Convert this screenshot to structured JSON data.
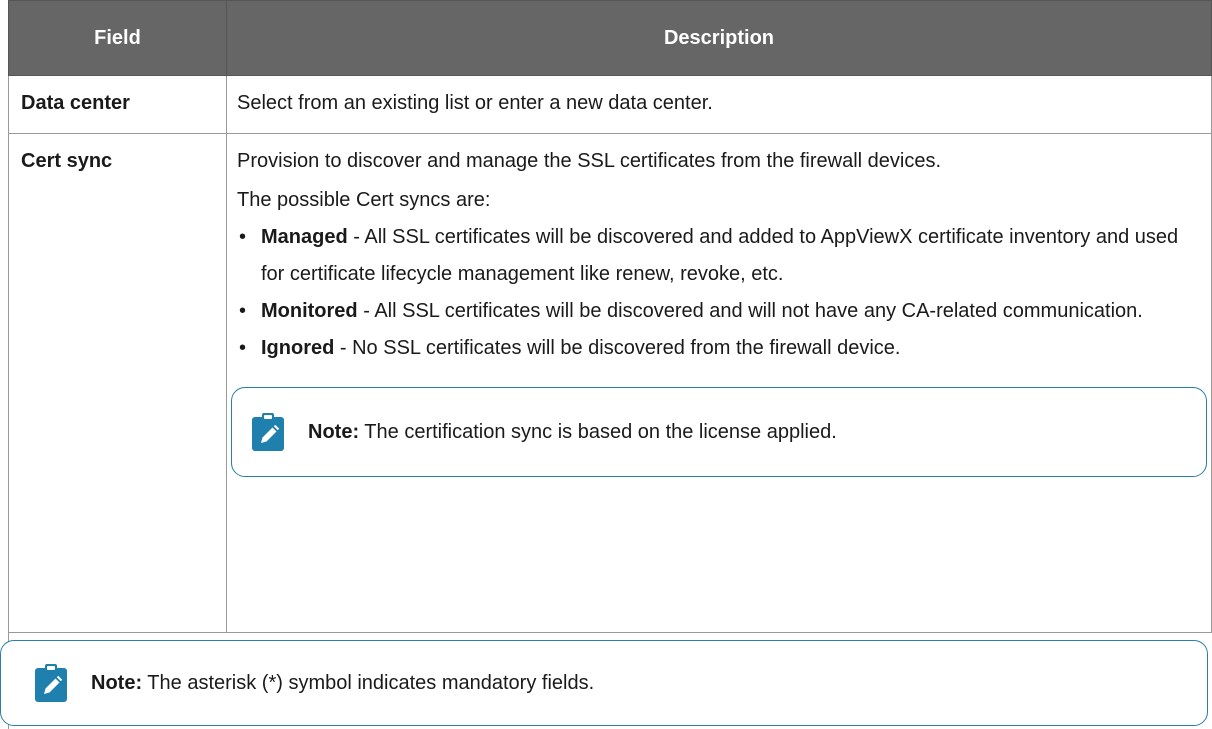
{
  "table": {
    "headers": {
      "field": "Field",
      "description": "Description"
    },
    "rows": {
      "data_center": {
        "field": "Data center",
        "description": "Select from an existing list or enter a new data center."
      },
      "cert_sync": {
        "field": "Cert sync",
        "intro": "Provision to discover and manage the SSL certificates from the firewall devices.",
        "possible": "The possible Cert syncs are:",
        "bullets": [
          {
            "term": "Managed",
            "text": " - All SSL certificates will be discovered and added to AppViewX certificate inventory and used for certificate lifecycle management like renew, revoke, etc."
          },
          {
            "term": "Monitored",
            "text": " - All SSL certificates will be discovered and will not have any CA-related communication."
          },
          {
            "term": "Ignored",
            "text": " - No SSL certificates will be discovered from the firewall device."
          }
        ],
        "note": {
          "label": "Note:",
          "text": " The certification sync is based on the license applied."
        }
      }
    }
  },
  "footer_note": {
    "label": "Note:",
    "text": " The asterisk (*) symbol indicates mandatory fields."
  },
  "colors": {
    "header_bg": "#666666",
    "note_border": "#2a7fa8",
    "note_icon": "#1f7fad"
  },
  "icons": {
    "note": "pencil-clipboard-icon"
  }
}
